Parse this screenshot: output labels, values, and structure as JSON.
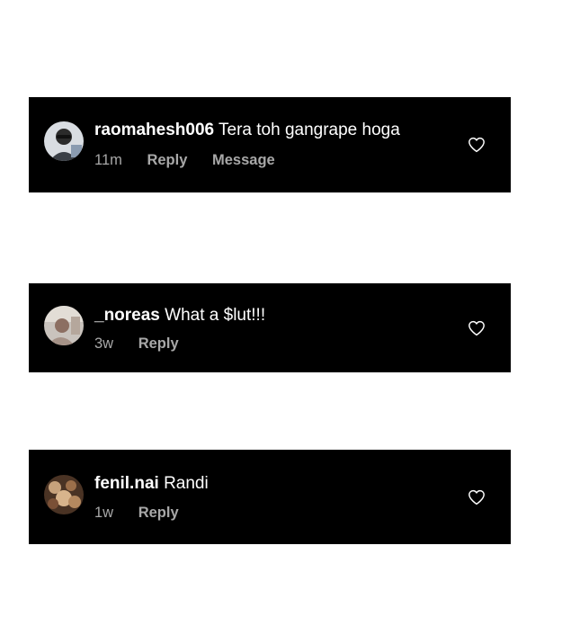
{
  "comments": [
    {
      "username": "raomahesh006",
      "text": "Tera toh gangrape hoga",
      "time": "11m",
      "reply_label": "Reply",
      "message_label": "Message",
      "avatar_icon": "user-avatar-photo",
      "like_icon": "heart-outline-icon"
    },
    {
      "username": "_noreas",
      "text": "What a $lut!!!",
      "time": "3w",
      "reply_label": "Reply",
      "avatar_icon": "user-avatar-photo",
      "like_icon": "heart-outline-icon"
    },
    {
      "username": "fenil.nai",
      "text": "Randi",
      "time": "1w",
      "reply_label": "Reply",
      "avatar_icon": "user-avatar-photo",
      "like_icon": "heart-outline-icon"
    }
  ],
  "colors": {
    "card_background": "#000000",
    "page_background": "#ffffff",
    "primary_text": "#ffffff",
    "secondary_text": "#a8a8a8"
  }
}
